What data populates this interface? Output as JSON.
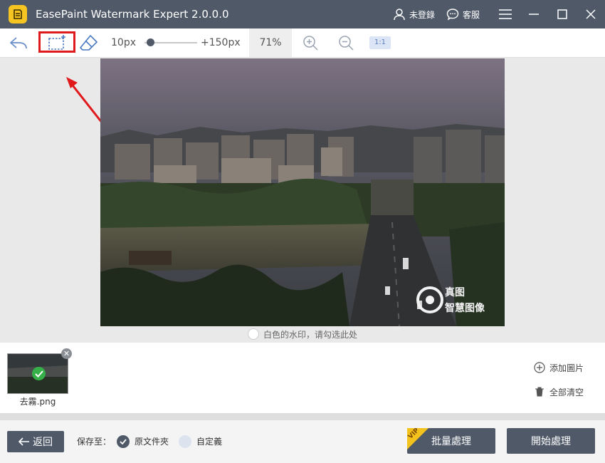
{
  "titlebar": {
    "title": "EasePaint Watermark Expert  2.0.0.0",
    "login_label": "未登錄",
    "support_label": "客服"
  },
  "toolbar": {
    "min_size": "10px",
    "max_size": "+150px",
    "zoom": "71%",
    "actual_size": "1:1",
    "brush_position": 0.1
  },
  "canvas": {
    "photo_watermark_line1": "真图",
    "photo_watermark_line2": "智慧图像",
    "white_watermark_hint": "白色的水印，请勾选此处"
  },
  "files": {
    "items": [
      {
        "name": "去霧.png"
      }
    ],
    "add_image_label": "添加圖片",
    "clear_all_label": "全部清空"
  },
  "bottom": {
    "back_label": "返回",
    "save_to_label": "保存至：",
    "original_folder_label": "原文件夾",
    "custom_label": "自定義",
    "batch_label": "批量處理",
    "start_label": "開始處理",
    "vip_label": "VIP"
  },
  "colors": {
    "titlebar": "#4f5968",
    "accent_red": "#e0191c",
    "check_green": "#36b14a",
    "vip_gold": "#f4c21d"
  }
}
